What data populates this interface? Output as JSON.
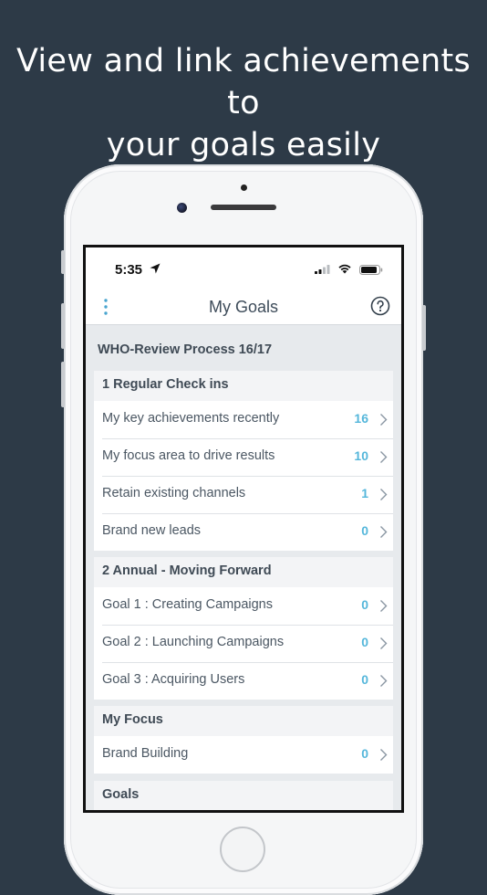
{
  "headline": {
    "line1": "View and link achievements to",
    "line2": "your goals easily"
  },
  "status": {
    "time": "5:35"
  },
  "nav": {
    "title": "My Goals"
  },
  "review": {
    "title": "WHO-Review Process 16/17"
  },
  "sections": [
    {
      "title": "1 Regular Check ins",
      "items": [
        {
          "label": "My key achievements recently",
          "count": "16"
        },
        {
          "label": "My focus area to drive results",
          "count": "10"
        },
        {
          "label": "Retain existing channels",
          "count": "1"
        },
        {
          "label": "Brand new leads",
          "count": "0"
        }
      ]
    },
    {
      "title": "2 Annual - Moving Forward",
      "items": [
        {
          "label": "Goal 1 : Creating Campaigns",
          "count": "0"
        },
        {
          "label": "Goal 2 : Launching Campaigns",
          "count": "0"
        },
        {
          "label": "Goal 3 : Acquiring Users",
          "count": "0"
        }
      ]
    },
    {
      "title": "My Focus",
      "items": [
        {
          "label": "Brand Building",
          "count": "0"
        }
      ]
    },
    {
      "title": "Goals",
      "items": []
    }
  ],
  "colors": {
    "background": "#2d3a47",
    "accent": "#55b7db",
    "text": "#3f4a55"
  }
}
